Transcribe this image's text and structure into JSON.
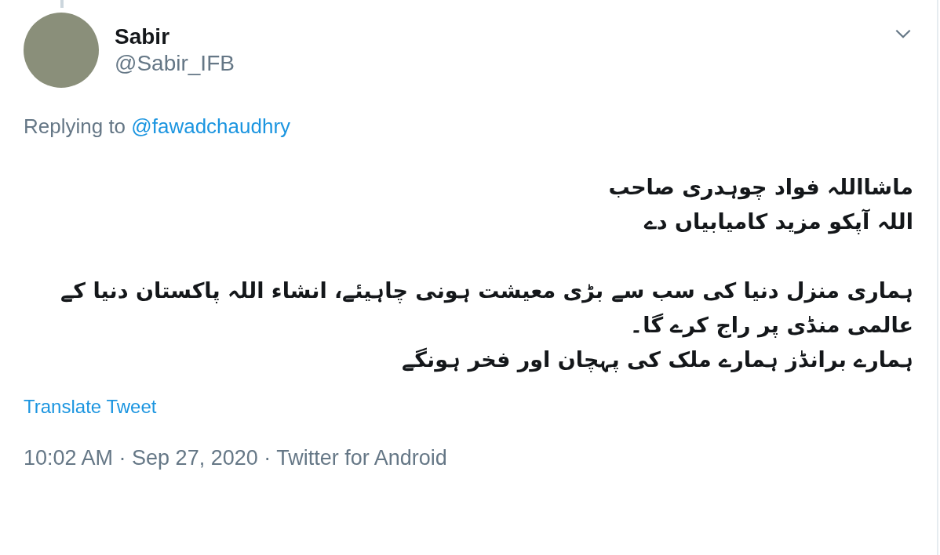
{
  "author": {
    "name": "Sabir",
    "handle": "@Sabir_IFB"
  },
  "reply": {
    "prefix": "Replying to",
    "mention": "@fawadchaudhry"
  },
  "body": {
    "paragraphs": [
      "ماشااللہ فواد چوہدری صاحب\nاللہ آپکو مزید کامیابیاں دے",
      "ہماری منزل دنیا کی سب سے بڑی معیشت ہونی چاہیئے، انشاء اللہ پاکستان دنیا کے عالمی منڈی پر راج کرے گا۔\nہمارے برانڈز ہمارے ملک کی پہچان اور فخر ہونگے"
    ]
  },
  "translate": "Translate Tweet",
  "meta": "10:02 AM · Sep 27, 2020 · Twitter for Android"
}
